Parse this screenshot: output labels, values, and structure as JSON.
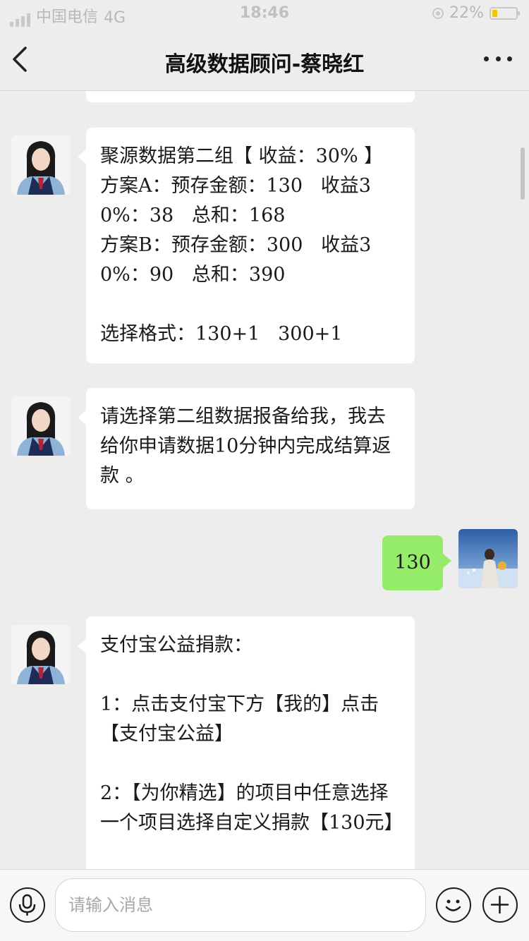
{
  "status_bar": {
    "carrier": "中国电信",
    "network": "4G",
    "time": "18:46",
    "battery_percent": "22%",
    "battery_level": 0.22
  },
  "nav": {
    "title": "高级数据顾问-蔡晓红",
    "back_icon": "chevron-left-icon",
    "more_icon": "more-dots-icon"
  },
  "messages": [
    {
      "side": "left",
      "text": "聚源数据第二组【 收益：30% 】\n方案A：预存金额：130   收益30%：38   总和：168\n方案B：预存金额：300   收益30%：90   总和：390\n\n选择格式：130+1   300+1"
    },
    {
      "side": "left",
      "text": "请选择第二组数据报备给我，我去给你申请数据10分钟内完成结算返款 。"
    },
    {
      "side": "right",
      "text": "130"
    },
    {
      "side": "left",
      "text": "支付宝公益捐款：\n\n1：点击支付宝下方【我的】点击【支付宝公益】\n\n2：【为你精选】的项目中任意选择一个项目选择自定义捐款【130元】"
    }
  ],
  "input_bar": {
    "placeholder": "请输入消息",
    "voice_icon": "microphone-icon",
    "emoji_icon": "smiley-icon",
    "plus_icon": "plus-icon"
  },
  "colors": {
    "background": "#ededed",
    "bubble_left": "#ffffff",
    "bubble_right": "#95ec69",
    "battery": "#f5c400"
  }
}
